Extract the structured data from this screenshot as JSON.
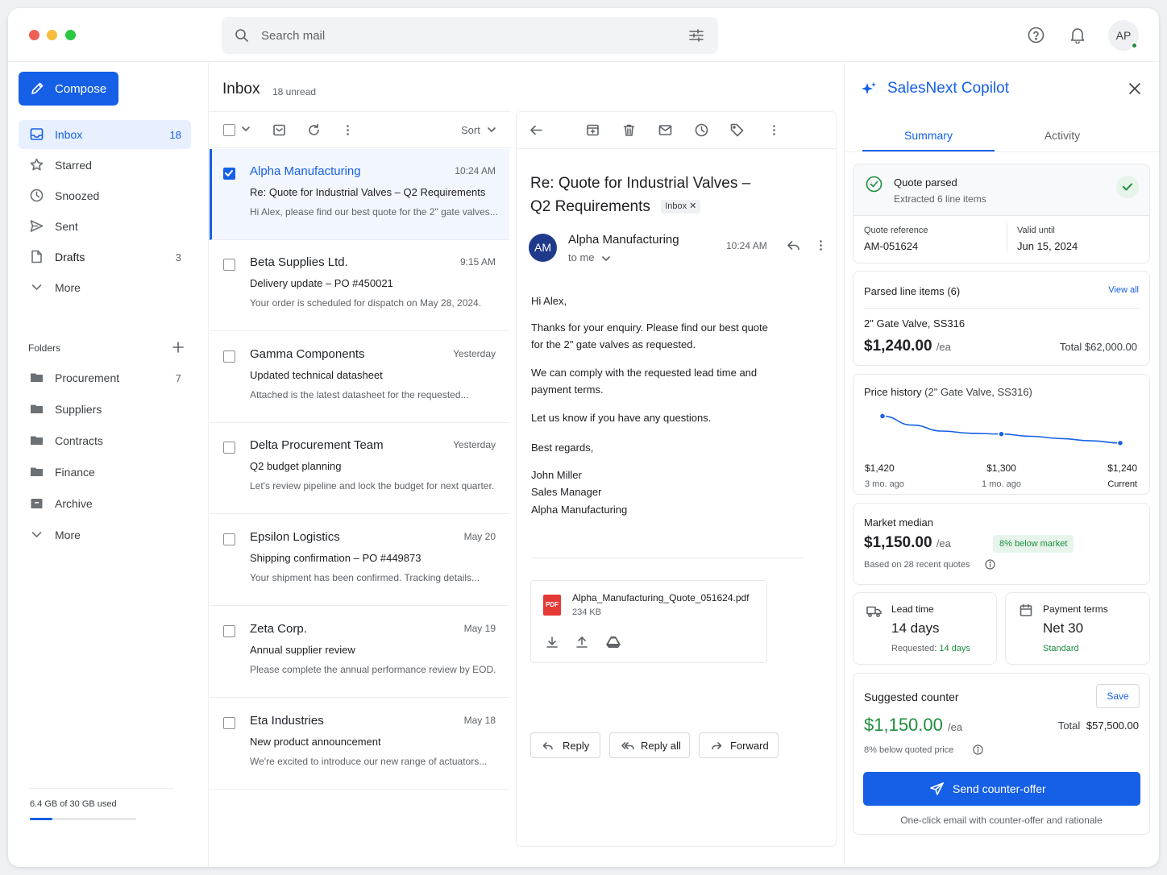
{
  "window": {
    "colors": {
      "close": "#ee5f57",
      "min": "#f6bd3b",
      "max": "#29c840",
      "accent": "#1560e6",
      "green": "#1e8e3e"
    }
  },
  "topbar": {
    "search_placeholder": "Search mail",
    "avatar_initials": "AP"
  },
  "sidebar": {
    "compose_label": "Compose",
    "nav": [
      {
        "label": "Inbox",
        "count": "18"
      },
      {
        "label": "Starred",
        "count": ""
      },
      {
        "label": "Snoozed",
        "count": ""
      },
      {
        "label": "Sent",
        "count": ""
      },
      {
        "label": "Drafts",
        "count": "3"
      },
      {
        "label": "More",
        "count": ""
      }
    ],
    "folders_title": "Folders",
    "folders": [
      {
        "label": "Procurement",
        "count": "7"
      },
      {
        "label": "Suppliers",
        "count": ""
      },
      {
        "label": "Contracts",
        "count": ""
      },
      {
        "label": "Finance",
        "count": ""
      },
      {
        "label": "Archive",
        "count": ""
      }
    ],
    "folders_more": "More",
    "storage_text": "6.4 GB of 30 GB used",
    "storage_fraction": 0.213
  },
  "inbox": {
    "title": "Inbox",
    "unread": "18 unread",
    "sort_label": "Sort",
    "messages": [
      {
        "from": "Alpha Manufacturing",
        "time": "10:24 AM",
        "subject": "Re: Quote for Industrial Valves – Q2 Requirements",
        "preview": "Hi Alex, please find our best quote for the 2\" gate valves...",
        "selected": true
      },
      {
        "from": "Beta Supplies Ltd.",
        "time": "9:15 AM",
        "subject": "Delivery update – PO #450021",
        "preview": "Your order is scheduled for dispatch on May 28, 2024.",
        "selected": false
      },
      {
        "from": "Gamma Components",
        "time": "Yesterday",
        "subject": "Updated technical datasheet",
        "preview": "Attached is the latest datasheet for the requested...",
        "selected": false
      },
      {
        "from": "Delta Procurement Team",
        "time": "Yesterday",
        "subject": "Q2 budget planning",
        "preview": "Let's review pipeline and lock the budget for next quarter.",
        "selected": false
      },
      {
        "from": "Epsilon Logistics",
        "time": "May 20",
        "subject": "Shipping confirmation – PO #449873",
        "preview": "Your shipment has been confirmed. Tracking details...",
        "selected": false
      },
      {
        "from": "Zeta Corp.",
        "time": "May 19",
        "subject": "Annual supplier review",
        "preview": "Please complete the annual performance review by EOD.",
        "selected": false
      },
      {
        "from": "Eta Industries",
        "time": "May 18",
        "subject": "New product announcement",
        "preview": "We're excited to introduce our new range of actuators...",
        "selected": false
      }
    ]
  },
  "reader": {
    "subject_line1": "Re: Quote for Industrial Valves –",
    "subject_line2": "Q2 Requirements",
    "label_chip": "Inbox",
    "sender_initials": "AM",
    "sender": "Alpha Manufacturing",
    "to": "to me",
    "time": "10:24 AM",
    "body": [
      "Hi Alex,",
      "Thanks for your enquiry. Please find our best quote",
      "for the 2\" gate valves as requested.",
      "We can comply with the requested lead time and",
      "payment terms.",
      "Let us know if you have any questions.",
      "Best regards,",
      "John Miller",
      "Sales Manager",
      "Alpha Manufacturing"
    ],
    "attachment": {
      "name": "Alpha_Manufacturing_Quote_051624.pdf",
      "size": "234 KB",
      "badge": "PDF"
    },
    "reply_label": "Reply",
    "reply_all_label": "Reply all",
    "forward_label": "Forward"
  },
  "copilot": {
    "title": "SalesNext Copilot",
    "tabs": [
      "Summary",
      "Activity"
    ],
    "status_title": "Quote parsed",
    "status_sub": "Extracted 6 line items",
    "quote_ref_label": "Quote reference",
    "quote_ref": "AM-051624",
    "valid_label": "Valid until",
    "valid": "Jun 15, 2024",
    "parsed_title": "Parsed line items (6)",
    "view_all": "View all",
    "item_name": "2\" Gate Valve, SS316",
    "item_price": "$1,240.00",
    "per_ea": "/ea",
    "item_total": "Total $62,000.00",
    "price_history_title": "Price history",
    "price_history_sub": "(2\" Gate Valve, SS316)",
    "market_title": "Market median",
    "market_price": "$1,150.00",
    "market_badge": "8% below market",
    "market_basis": "Based on 28 recent quotes",
    "lead_title": "Lead time",
    "lead_value": "14 days",
    "lead_req_label": "Requested:",
    "lead_req": "14 days",
    "pay_title": "Payment terms",
    "pay_value": "Net 30",
    "pay_sub": "Standard",
    "counter_title": "Suggested counter",
    "save_label": "Save",
    "counter_price": "$1,150.00",
    "counter_total_label": "Total",
    "counter_total": "$57,500.00",
    "counter_note": "8% below quoted price",
    "send_label": "Send counter-offer",
    "send_note": "One-click email with counter-offer and rationale"
  },
  "chart_data": {
    "type": "line",
    "title": "Price history",
    "categories": [
      "3 mo. ago",
      "1 mo. ago",
      "Current"
    ],
    "x_labels": [
      "3 mo. ago",
      "",
      "",
      "",
      "1 mo. ago",
      "",
      "",
      "",
      "Current"
    ],
    "series": [
      {
        "values": [
          1420,
          1360,
          1320,
          1305,
          1300,
          1285,
          1270,
          1255,
          1240
        ]
      }
    ],
    "point_labels": [
      "$1,420",
      "$1,300",
      "$1,240"
    ],
    "marked_indices": [
      0,
      4,
      8
    ],
    "ylim": [
      1180,
      1460
    ]
  }
}
